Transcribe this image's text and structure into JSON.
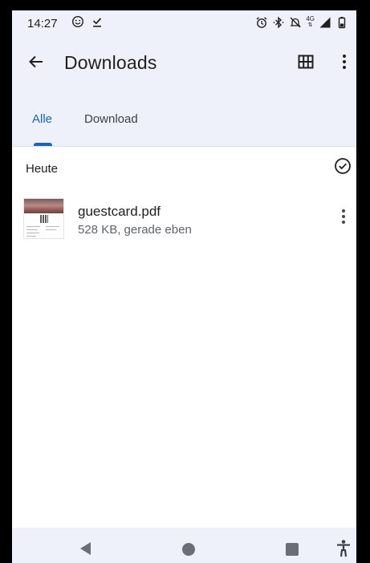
{
  "status_bar": {
    "time": "14:27",
    "left_icons": [
      "emoji-icon",
      "download-done-icon"
    ],
    "right_icons": [
      "alarm-icon",
      "bluetooth-icon",
      "mute-icon",
      "network-4g-icon",
      "signal-icon",
      "battery-icon"
    ],
    "network_label": "4G"
  },
  "app_bar": {
    "title": "Downloads",
    "back_icon": "arrow-back-icon",
    "grid_icon": "grid-view-icon",
    "menu_icon": "more-vert-icon"
  },
  "tabs": [
    {
      "label": "Alle",
      "active": true
    },
    {
      "label": "Download",
      "active": false
    }
  ],
  "section": {
    "header": "Heute",
    "select_icon": "check-circle-icon"
  },
  "files": [
    {
      "name": "guestcard.pdf",
      "meta": "528 KB, gerade eben",
      "thumbnail": "pdf-thumbnail"
    }
  ],
  "nav_bar": {
    "icons": [
      "nav-back-icon",
      "nav-home-icon",
      "nav-recents-icon",
      "accessibility-icon"
    ]
  },
  "colors": {
    "accent": "#1a61c4",
    "surface": "#eef1f9",
    "text": "#1f1f1f",
    "secondary_text": "#5f6368"
  }
}
